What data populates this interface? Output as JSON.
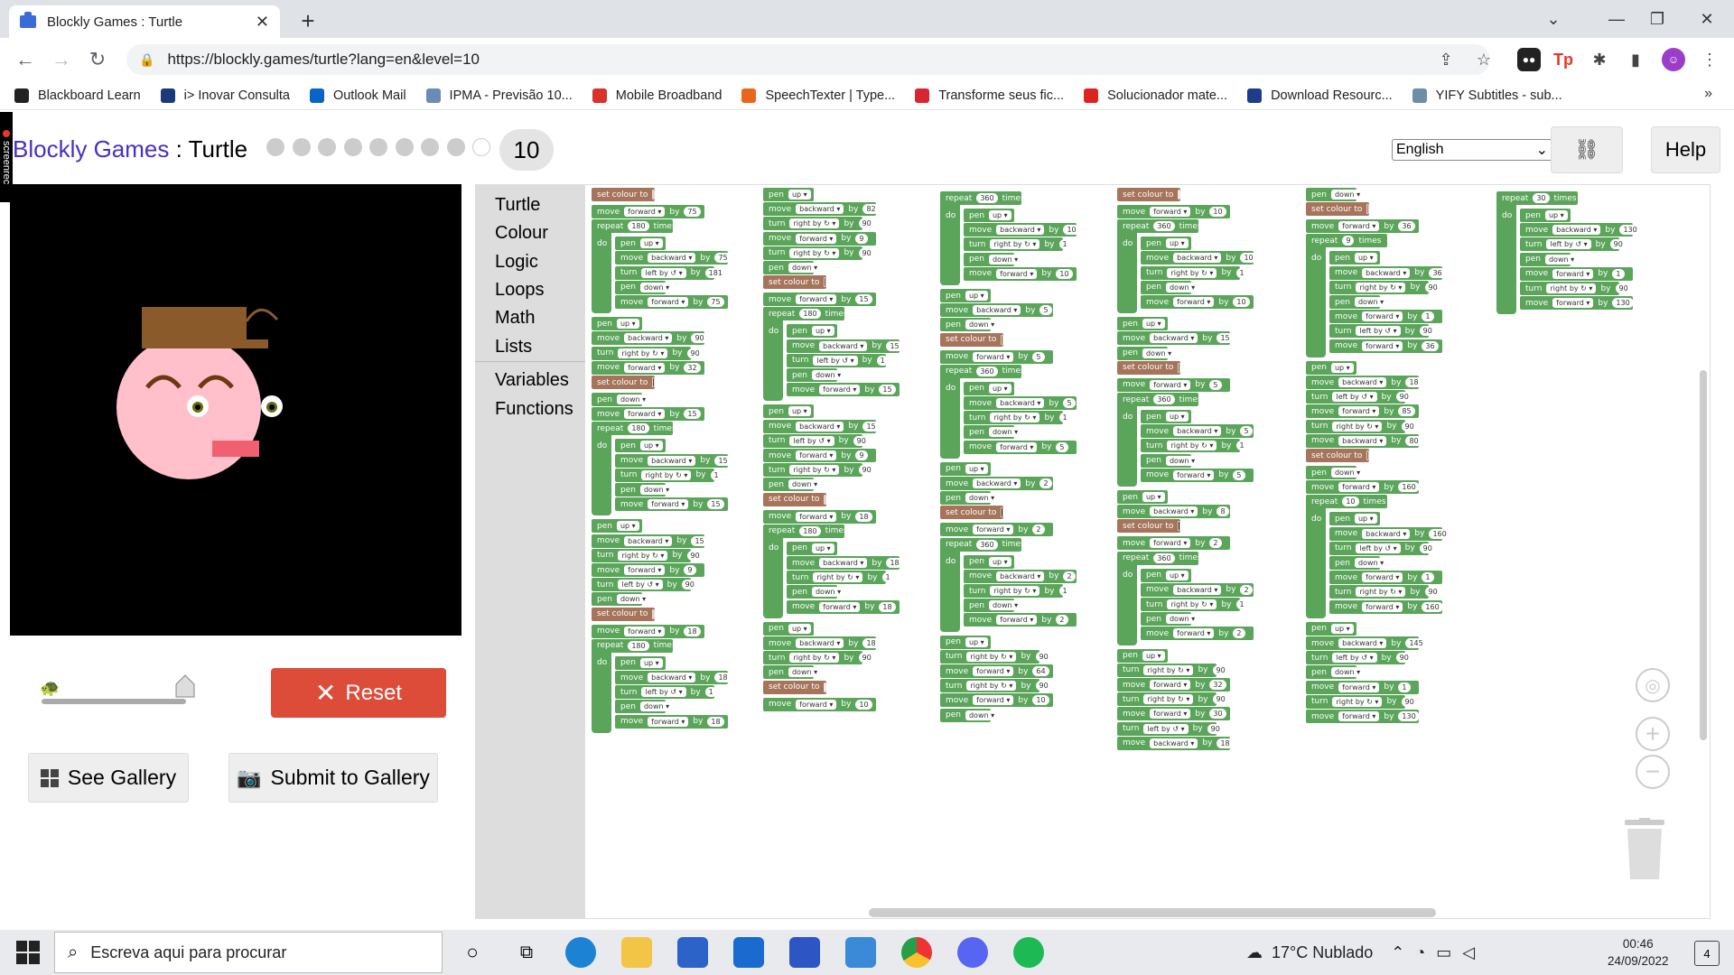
{
  "browser": {
    "tab_title": "Blockly Games : Turtle",
    "url": "https://blockly.games/turtle?lang=en&level=10",
    "bookmarks": [
      "Blackboard Learn",
      "i> Inovar Consulta",
      "Outlook Mail",
      "IPMA - Previsão 10...",
      "Mobile Broadband",
      "SpeechTexter | Type...",
      "Transforme seus fic...",
      "Solucionador mate...",
      "Download Resourc...",
      "YIFY Subtitles - sub..."
    ],
    "bookmark_colors": [
      "#222",
      "#1a3a7a",
      "#0a64c8",
      "#6b8bb5",
      "#d8322a",
      "#e8671a",
      "#d7262f",
      "#d22",
      "#1e3c8c",
      "#6d8ea8"
    ]
  },
  "app": {
    "title_link": "Blockly Games",
    "title_sep": " : Turtle",
    "level": "10",
    "levels_total": 10,
    "language": "English",
    "help_label": "Help",
    "reset_label": "Reset",
    "gallery_label": "See Gallery",
    "submit_label": "Submit to Gallery",
    "screenrec_label": "screenrec"
  },
  "toolbox": {
    "categories": [
      "Turtle",
      "Colour",
      "Logic",
      "Loops",
      "Math",
      "Lists"
    ],
    "categories2": [
      "Variables",
      "Functions"
    ]
  },
  "drawing": {
    "background": "#000000",
    "face_color": "#ffc0cb",
    "hat_color": "#8b5a2b",
    "eye_color": "#6b6b10",
    "brow_color": "#6b3a14",
    "mouth_color": "#f06070"
  },
  "block_colors": {
    "motion": "#5ba55b",
    "loop": "#5ba55b",
    "colour": "#a5745b",
    "number_border": "#ddd"
  },
  "columns": [
    [
      "colour:#ffc0cb",
      "move|forward|75",
      "rep|180",
      "+pen|up",
      "+move|backward|75",
      "+turn|left by ↺|181",
      "+pen|down",
      "+move|forward|75",
      "pen|up",
      "move|backward|90",
      "turn|right by ↻|90",
      "move|forward|32",
      "colour:#6b3a14",
      "pen|down",
      "move|forward|15",
      "rep|180",
      "+pen|up",
      "+move|backward|15",
      "+turn|right by ↻|1",
      "+pen|down",
      "+move|forward|15",
      "pen|up",
      "move|backward|15",
      "turn|right by ↻|90",
      "move|forward|9",
      "turn|left by ↺|90",
      "pen|down",
      "colour:#ffc0cb",
      "move|forward|18",
      "rep|180",
      "+pen|up",
      "+move|backward|18",
      "+turn|left by ↺|1",
      "+pen|down",
      "+move|forward|18"
    ],
    [
      "pen|up",
      "move|backward|82",
      "turn|right by ↻|90",
      "move|forward|9",
      "turn|right by ↻|90",
      "pen|down",
      "colour:#6b3a14",
      "move|forward|15",
      "rep|180",
      "+pen|up",
      "+move|backward|15",
      "+turn|left by ↺|1",
      "+pen|down",
      "+move|forward|15",
      "pen|up",
      "move|backward|15",
      "turn|left by ↺|90",
      "move|forward|9",
      "turn|right by ↻|90",
      "pen|down",
      "colour:#ffc0cb",
      "move|forward|18",
      "rep|180",
      "+pen|up",
      "+move|backward|18",
      "+turn|right by ↻|1",
      "+pen|down",
      "+move|forward|18",
      "pen|up",
      "move|backward|18",
      "turn|right by ↻|90",
      "pen|down",
      "colour:#ffffff",
      "move|forward|10"
    ],
    [
      "rep|360",
      "+pen|up",
      "+move|backward|10",
      "+turn|right by ↻|1",
      "+pen|down",
      "+move|forward|10",
      "pen|up",
      "move|backward|5",
      "pen|down",
      "colour:#6b6b10",
      "move|forward|5",
      "rep|360",
      "+pen|up",
      "+move|backward|5",
      "+turn|right by ↻|1",
      "+pen|down",
      "+move|forward|5",
      "pen|up",
      "move|backward|2",
      "pen|down",
      "colour:#000000",
      "move|forward|2",
      "rep|360",
      "+pen|up",
      "+move|backward|2",
      "+turn|right by ↻|1",
      "+pen|down",
      "+move|forward|2",
      "pen|up",
      "turn|right by ↻|90",
      "move|forward|64",
      "turn|right by ↻|90",
      "move|forward|10",
      "pen|down"
    ],
    [
      "colour:#ffffff",
      "move|forward|10",
      "rep|360",
      "+pen|up",
      "+move|backward|10",
      "+turn|right by ↻|1",
      "+pen|down",
      "+move|forward|10",
      "pen|up",
      "move|backward|15",
      "pen|down",
      "colour:#6b6b10",
      "move|forward|5",
      "rep|360",
      "+pen|up",
      "+move|backward|5",
      "+turn|right by ↻|1",
      "+pen|down",
      "+move|forward|5",
      "pen|up",
      "move|backward|8",
      "colour:#000000",
      "move|forward|2",
      "rep|360",
      "+pen|up",
      "+move|backward|2",
      "+turn|right by ↻|1",
      "+pen|down",
      "+move|forward|2",
      "pen|up",
      "turn|right by ↻|90",
      "move|forward|32",
      "turn|right by ↻|90",
      "move|forward|30",
      "turn|left by ↺|90",
      "move|backward|18"
    ],
    [
      "pen|down",
      "colour:#f06070",
      "move|forward|36",
      "rep|9",
      "+pen|up",
      "+move|backward|36",
      "+turn|right by ↻|90",
      "+pen|down",
      "+move|forward|1",
      "+turn|left by ↺|90",
      "+move|forward|36",
      "pen|up",
      "move|backward|18",
      "turn|left by ↺|90",
      "move|forward|85",
      "turn|right by ↻|90",
      "move|backward|80",
      "colour:#8b5a2b",
      "pen|down",
      "move|forward|160",
      "rep|10",
      "+pen|up",
      "+move|backward|160",
      "+turn|left by ↺|90",
      "+pen|down",
      "+move|forward|1",
      "+turn|right by ↻|90",
      "+move|forward|160",
      "pen|up",
      "move|backward|145",
      "turn|left by ↺|90",
      "pen|down",
      "move|forward|1",
      "turn|right by ↻|90",
      "move|forward|130"
    ],
    [
      "rep|30",
      "+pen|up",
      "+move|backward|130",
      "+turn|left by ↺|90",
      "+pen|down",
      "+move|forward|1",
      "+turn|right by ↻|90",
      "+move|forward|130"
    ]
  ],
  "block_text": {
    "set_colour": "set colour to",
    "move": "move",
    "turn": "turn",
    "pen": "pen",
    "repeat": "repeat",
    "times": "times",
    "do": "do",
    "by": "by"
  },
  "taskbar": {
    "search_placeholder": "Escreva aqui para procurar",
    "weather": "17°C  Nublado",
    "time": "00:46",
    "date": "24/09/2022",
    "notifications": "4"
  }
}
